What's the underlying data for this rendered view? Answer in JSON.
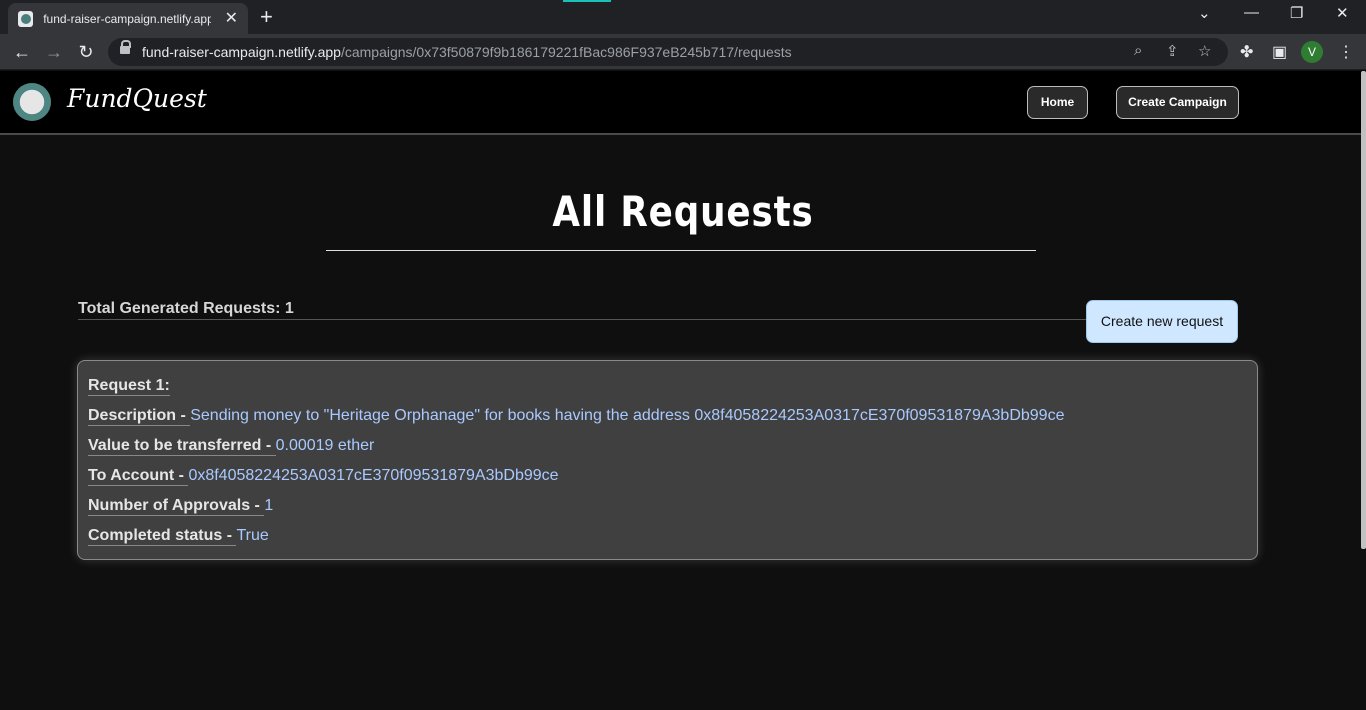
{
  "browser": {
    "tab_title": "fund-raiser-campaign.netlify.app/c",
    "tab_close": "✕",
    "new_tab": "+",
    "url_host": "fund-raiser-campaign.netlify.app",
    "url_path": "/campaigns/0x73f50879f9b186179221fBac986F937eB245b717/requests",
    "profile_initial": "V",
    "window_controls": [
      "⌄",
      "—",
      "❐",
      "✕"
    ]
  },
  "navbar": {
    "brand": "FundQuest",
    "home_label": "Home",
    "create_campaign_label": "Create Campaign"
  },
  "main": {
    "heading": "All Requests",
    "total_label": "Total Generated Requests: 1",
    "create_request_label": "Create new request"
  },
  "request_card": {
    "title": "Request 1:",
    "fields": [
      {
        "label": "Description - ",
        "value": "Sending money to \"Heritage Orphanage\" for books having the address 0x8f4058224253A0317cE370f09531879A3bDb99ce"
      },
      {
        "label": "Value to be transferred - ",
        "value": "0.00019 ether"
      },
      {
        "label": "To Account - ",
        "value": "0x8f4058224253A0317cE370f09531879A3bDb99ce"
      },
      {
        "label": "Number of Approvals - ",
        "value": "1"
      },
      {
        "label": "Completed status - ",
        "value": "True"
      }
    ]
  },
  "colors": {
    "page_bg": "#0f0f10",
    "navbar_bg": "#000000",
    "card_bg": "#404040",
    "value_text": "#a9c9ff",
    "create_request_bg": "#cfe8ff",
    "profile_bg": "#2e7d32"
  },
  "icons": [
    "back-arrow-icon",
    "forward-arrow-icon",
    "reload-icon",
    "lock-icon",
    "zoom-icon",
    "share-icon",
    "star-icon",
    "extensions-icon",
    "side-panel-icon",
    "menu-icon"
  ]
}
